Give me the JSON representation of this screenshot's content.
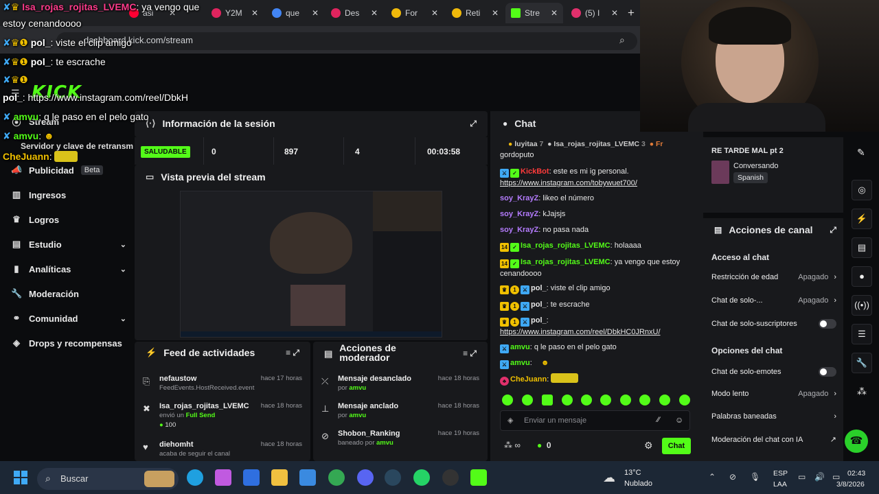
{
  "browser": {
    "tabs": [
      {
        "label": "asi",
        "color": "#ff0033"
      },
      {
        "label": "Y2M",
        "color": "#e0245e"
      },
      {
        "label": "que",
        "color": "#4285f4"
      },
      {
        "label": "Des",
        "color": "#e0245e"
      },
      {
        "label": "For",
        "color": "#f0b90b"
      },
      {
        "label": "Reti",
        "color": "#f0b90b"
      },
      {
        "label": "Stre",
        "color": "#53fc18"
      },
      {
        "label": "(5) I",
        "color": "#e1306c"
      }
    ],
    "url": "dashboard.kick.com/stream",
    "new_tab": "+"
  },
  "kick": {
    "logo": "KICK"
  },
  "sidebar": {
    "items": [
      {
        "label": "Stream",
        "icon": "stream-icon"
      },
      {
        "label": "Publicidad",
        "badge": "Beta",
        "icon": "megaphone-icon"
      },
      {
        "label": "Ingresos",
        "icon": "chart-icon"
      },
      {
        "label": "Logros",
        "icon": "trophy-icon"
      },
      {
        "label": "Estudio",
        "icon": "studio-icon",
        "chevron": "⌄"
      },
      {
        "label": "Analíticas",
        "icon": "analytics-icon",
        "chevron": "⌄"
      },
      {
        "label": "Moderación",
        "icon": "wrench-icon"
      },
      {
        "label": "Comunidad",
        "icon": "community-icon",
        "chevron": "⌄"
      },
      {
        "label": "Drops y recompensas",
        "icon": "drops-icon"
      }
    ],
    "server_key": "Servidor y clave de retransm"
  },
  "session": {
    "title": "Información de la sesión",
    "health": "SALUDABLE",
    "stats": [
      "0",
      "897",
      "4",
      "00:03:58"
    ]
  },
  "preview": {
    "title": "Vista previa del stream"
  },
  "feed": {
    "title": "Feed de actividades",
    "rows": [
      {
        "name": "nefaustow",
        "sub": "FeedEvents.HostReceived.event",
        "time": "hace 17 horas"
      },
      {
        "name": "Isa_rojas_rojitas_LVEMC",
        "sub": "envió un",
        "sub2": "Full Send",
        "amount": "100",
        "time": "hace 18 horas"
      },
      {
        "name": "diehomht",
        "sub": "acaba de seguir el canal",
        "time": "hace 18 horas"
      }
    ]
  },
  "modactions": {
    "title": "Acciones de moderador",
    "rows": [
      {
        "name": "Mensaje desanclado",
        "by": "por",
        "user": "amvu",
        "time": "hace 18 horas"
      },
      {
        "name": "Mensaje anclado",
        "by": "por",
        "user": "amvu",
        "time": "hace 18 horas"
      },
      {
        "name": "Shobon_Ranking",
        "by": "baneado por",
        "user": "amvu",
        "time": "hace 19 horas"
      }
    ]
  },
  "chat": {
    "title": "Chat",
    "top_gifters": [
      {
        "name": "luyitaa",
        "count": "7"
      },
      {
        "name": "Isa_rojas_rojitas_LVEMC",
        "count": "3"
      },
      {
        "name": "Fr",
        "count": ""
      }
    ],
    "messages": [
      {
        "user": "",
        "text": "gordoputo",
        "color": "#e8e8e8"
      },
      {
        "user": "KickBot",
        "text": "este es mi ig personal.",
        "link": "https://www.instagram.com/tobywuet700/",
        "color": "#ff3b3b"
      },
      {
        "user": "soy_KrayZ",
        "text": "likeo el número",
        "color": "#b57cff"
      },
      {
        "user": "soy_KrayZ",
        "text": "kJajsjs",
        "color": "#b57cff"
      },
      {
        "user": "soy_KrayZ",
        "text": "no pasa nada",
        "color": "#b57cff"
      },
      {
        "user": "Isa_rojas_rojitas_LVEMC",
        "text": "holaaaa",
        "color": "#53fc18"
      },
      {
        "user": "Isa_rojas_rojitas_LVEMC",
        "text": "ya vengo que estoy cenandoooo",
        "color": "#53fc18"
      },
      {
        "user": "pol_",
        "text": "viste el clip amigo",
        "color": "#ffffff"
      },
      {
        "user": "pol_",
        "text": "te escrache",
        "color": "#ffffff"
      },
      {
        "user": "pol_",
        "text": "",
        "link": "https://www.instagram.com/reel/DbkHC0JRnxU/",
        "color": "#ffffff"
      },
      {
        "user": "amvu",
        "text": "q le paso en el pelo gato",
        "color": "#53fc18"
      },
      {
        "user": "amvu",
        "text": "",
        "color": "#53fc18"
      },
      {
        "user": "CheJuann",
        "text": "",
        "color": "#f0c000"
      }
    ],
    "input_placeholder": "Enviar un mensaje",
    "points": "∞",
    "coins": "0",
    "send_label": "Chat"
  },
  "stream_card": {
    "title": "RE TARDE MAL pt 2",
    "category": "Conversando",
    "language": "Spanish"
  },
  "channel_actions": {
    "title": "Acciones de canal",
    "chat_access": "Acceso al chat",
    "rows": [
      {
        "label": "Restricción de edad",
        "value": "Apagado"
      },
      {
        "label": "Chat de solo-...",
        "value": "Apagado"
      },
      {
        "label": "Chat de solo-suscriptores",
        "value": ""
      }
    ],
    "chat_options": "Opciones del chat",
    "rows2": [
      {
        "label": "Chat de solo-emotes",
        "value": ""
      },
      {
        "label": "Modo lento",
        "value": "Apagado"
      },
      {
        "label": "Palabras baneadas",
        "value": ""
      },
      {
        "label": "Moderación del chat con IA",
        "value": ""
      }
    ]
  },
  "overlay": {
    "lines": [
      {
        "user": "Isa_rojas_rojitas_LVEMC",
        "text": ": ya vengo que"
      },
      {
        "user": "",
        "text": "estoy cenandoooo"
      },
      {
        "user": "pol_",
        "text": ": viste el clip amigo"
      },
      {
        "user": "pol_",
        "text": ": te escrache"
      },
      {
        "user": "pol_",
        "text": ": https://www.instagram.com/reel/DbkH"
      },
      {
        "user": "amvu",
        "text": ": q le paso en el pelo gato"
      },
      {
        "user": "amvu",
        "text": ":"
      },
      {
        "user": "CheJuann",
        "text": ":"
      }
    ]
  },
  "taskbar": {
    "search": "Buscar",
    "weather_temp": "13°C",
    "weather_desc": "Nublado",
    "lang": "ESP",
    "region": "LAA",
    "time": "02:43",
    "date": "3/8/2026"
  }
}
